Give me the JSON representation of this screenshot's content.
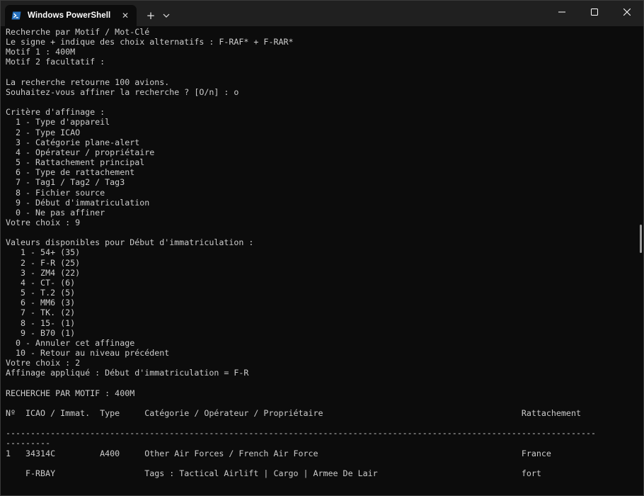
{
  "window": {
    "tab_title": "Windows PowerShell",
    "tab_icon": "powershell-icon",
    "close_tab_glyph": "✕",
    "new_tab_glyph": "+",
    "dropdown_glyph": "⌄",
    "minimize_glyph": "—",
    "maximize_glyph": "☐",
    "close_glyph": "✕",
    "accent_color": "#2671be"
  },
  "terminal": {
    "lines": [
      "Recherche par Motif / Mot-Clé",
      "Le signe + indique des choix alternatifs : F-RAF* + F-RAR*",
      "Motif 1 : 400M",
      "Motif 2 facultatif :",
      "",
      "La recherche retourne 100 avions.",
      "Souhaitez-vous affiner la recherche ? [O/n] : o",
      "",
      "Critère d'affinage :",
      "  1 - Type d'appareil",
      "  2 - Type ICAO",
      "  3 - Catégorie plane-alert",
      "  4 - Opérateur / propriétaire",
      "  5 - Rattachement principal",
      "  6 - Type de rattachement",
      "  7 - Tag1 / Tag2 / Tag3",
      "  8 - Fichier source",
      "  9 - Début d'immatriculation",
      "  0 - Ne pas affiner",
      "Votre choix : 9",
      "",
      "Valeurs disponibles pour Début d'immatriculation :",
      "   1 - 54+ (35)",
      "   2 - F-R (25)",
      "   3 - ZM4 (22)",
      "   4 - CT- (6)",
      "   5 - T.2 (5)",
      "   6 - MM6 (3)",
      "   7 - TK. (2)",
      "   8 - 15- (1)",
      "   9 - B70 (1)",
      "  0 - Annuler cet affinage",
      "  10 - Retour au niveau précédent",
      "Votre choix : 2",
      "Affinage appliqué : Début d'immatriculation = F-R",
      "",
      "RECHERCHE PAR MOTIF : 400M",
      "",
      "Nº  ICAO / Immat.  Type     Catégorie / Opérateur / Propriétaire                                        Rattachement",
      "",
      "-----------------------------------------------------------------------------------------------------------------------",
      "---------",
      "1   34314C         A400     Other Air Forces / French Air Force                                         France",
      "",
      "    F-RBAY                  Tags : Tactical Airlift | Cargo | Armee De Lair                             fort"
    ]
  }
}
